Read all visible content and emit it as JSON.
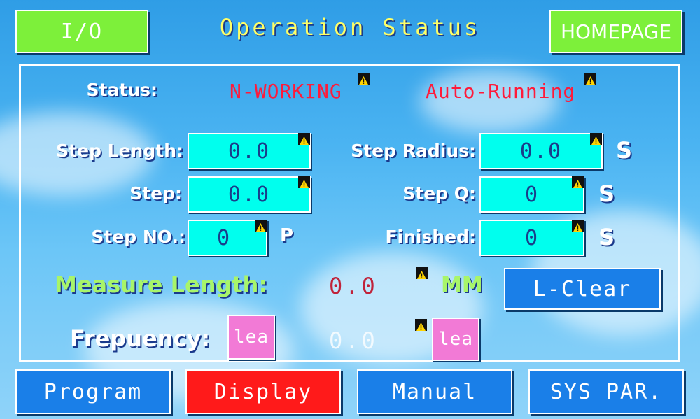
{
  "header": {
    "io_label": "I/O",
    "title": "Operation Status",
    "homepage_label": "HOMEPAGE"
  },
  "status": {
    "label": "Status:",
    "state1": "N-WORKING",
    "state2": "Auto-Running"
  },
  "fields": {
    "step_length": {
      "label": "Step Length:",
      "value": "0.0"
    },
    "step_radius": {
      "label": "Step Radius:",
      "value": "0.0",
      "unit": "S"
    },
    "step": {
      "label": "Step:",
      "value": "0.0"
    },
    "step_q": {
      "label": "Step Q:",
      "value": "0",
      "unit": "S"
    },
    "step_no": {
      "label": "Step NO.:",
      "value": "0",
      "unit": "P"
    },
    "finished": {
      "label": "Finished:",
      "value": "0",
      "unit": "S"
    }
  },
  "measure": {
    "label": "Measure Length:",
    "value": "0.0",
    "unit": "MM",
    "clear_label": "L-Clear"
  },
  "frequency": {
    "label": "Frepuency:",
    "button1_label": "lea",
    "value": "0.0",
    "button2_label": "lea"
  },
  "nav": {
    "program": "Program",
    "display": "Display",
    "manual": "Manual",
    "sys_par": "SYS PAR."
  },
  "colors": {
    "accent_green": "#7df03a",
    "button_blue": "#1a7fe8",
    "active_red": "#ff1a1a",
    "field_cyan": "#00ffee",
    "status_red": "#ff1a3a"
  }
}
